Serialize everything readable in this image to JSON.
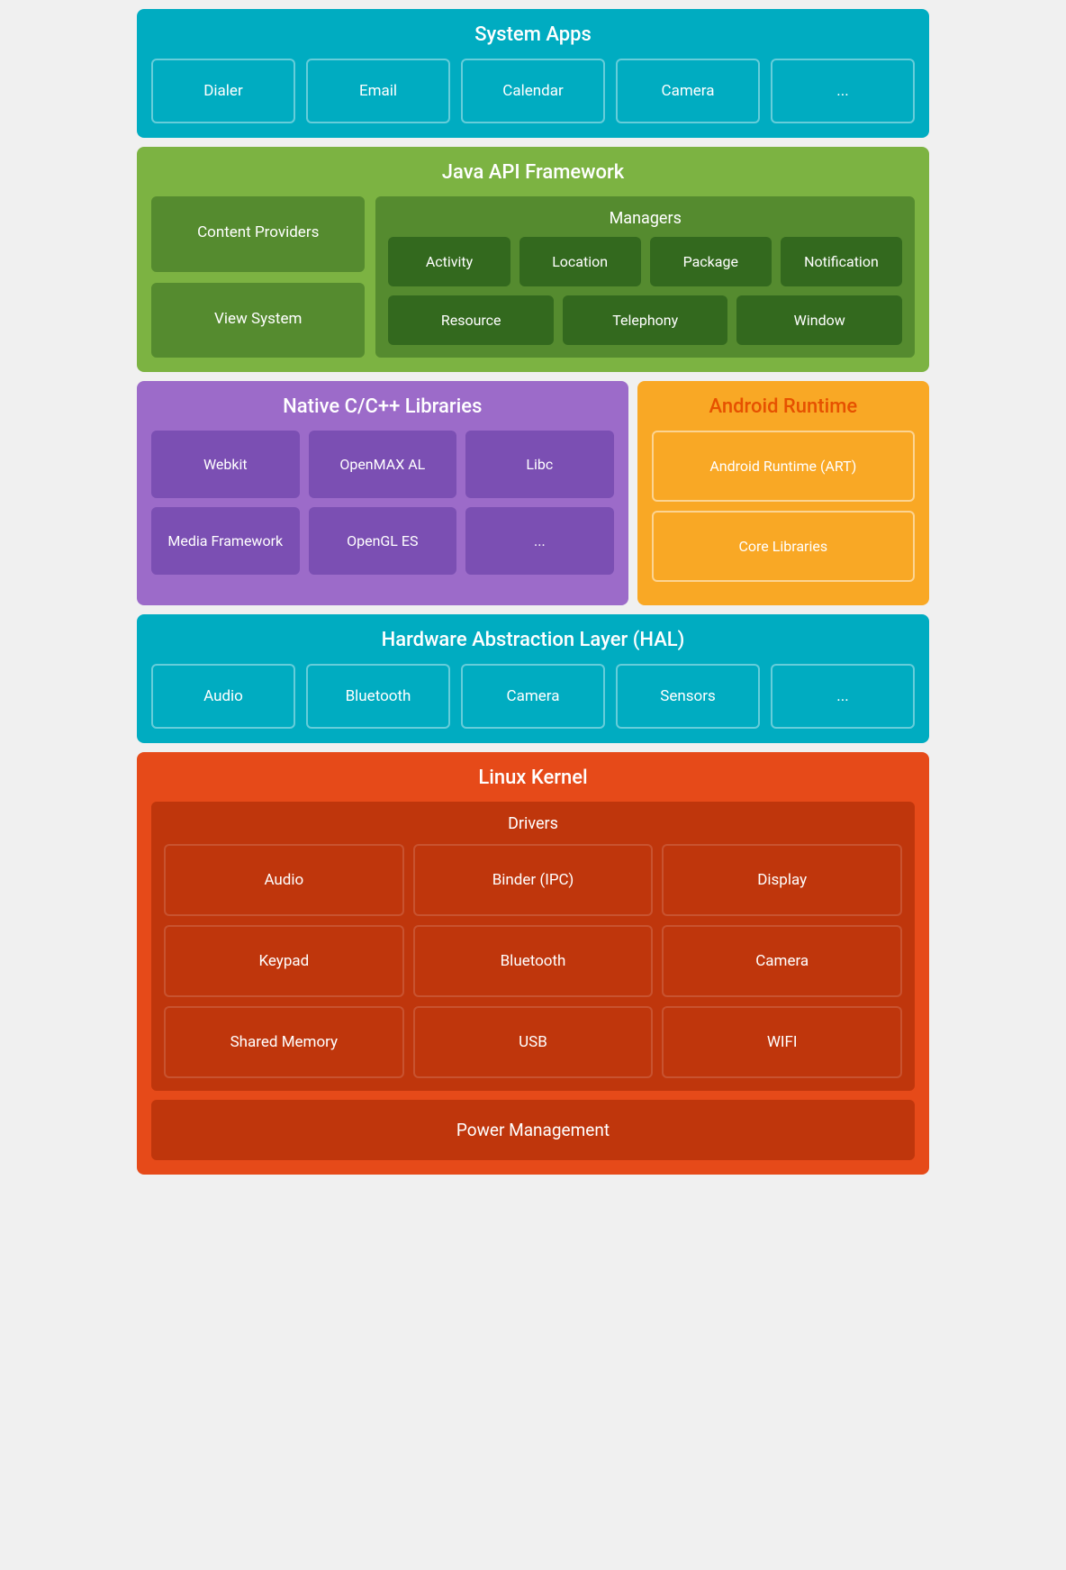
{
  "systemApps": {
    "title": "System Apps",
    "apps": [
      "Dialer",
      "Email",
      "Calendar",
      "Camera",
      "..."
    ]
  },
  "javaApi": {
    "title": "Java API Framework",
    "contentProviders": "Content Providers",
    "viewSystem": "View System",
    "managers": {
      "title": "Managers",
      "row1": [
        "Activity",
        "Location",
        "Package",
        "Notification"
      ],
      "row2": [
        "Resource",
        "Telephony",
        "Window"
      ]
    }
  },
  "nativeLibs": {
    "title": "Native C/C++ Libraries",
    "row1": [
      "Webkit",
      "OpenMAX AL",
      "Libc"
    ],
    "row2": [
      "Media Framework",
      "OpenGL ES",
      "..."
    ]
  },
  "androidRuntime": {
    "title": "Android Runtime",
    "art": "Android Runtime (ART)",
    "coreLibs": "Core Libraries"
  },
  "hal": {
    "title": "Hardware Abstraction Layer (HAL)",
    "items": [
      "Audio",
      "Bluetooth",
      "Camera",
      "Sensors",
      "..."
    ]
  },
  "linuxKernel": {
    "title": "Linux Kernel",
    "drivers": {
      "title": "Drivers",
      "row1": [
        "Audio",
        "Binder (IPC)",
        "Display"
      ],
      "row2": [
        "Keypad",
        "Bluetooth",
        "Camera"
      ],
      "row3": [
        "Shared Memory",
        "USB",
        "WIFI"
      ]
    },
    "powerMgmt": "Power Management"
  }
}
